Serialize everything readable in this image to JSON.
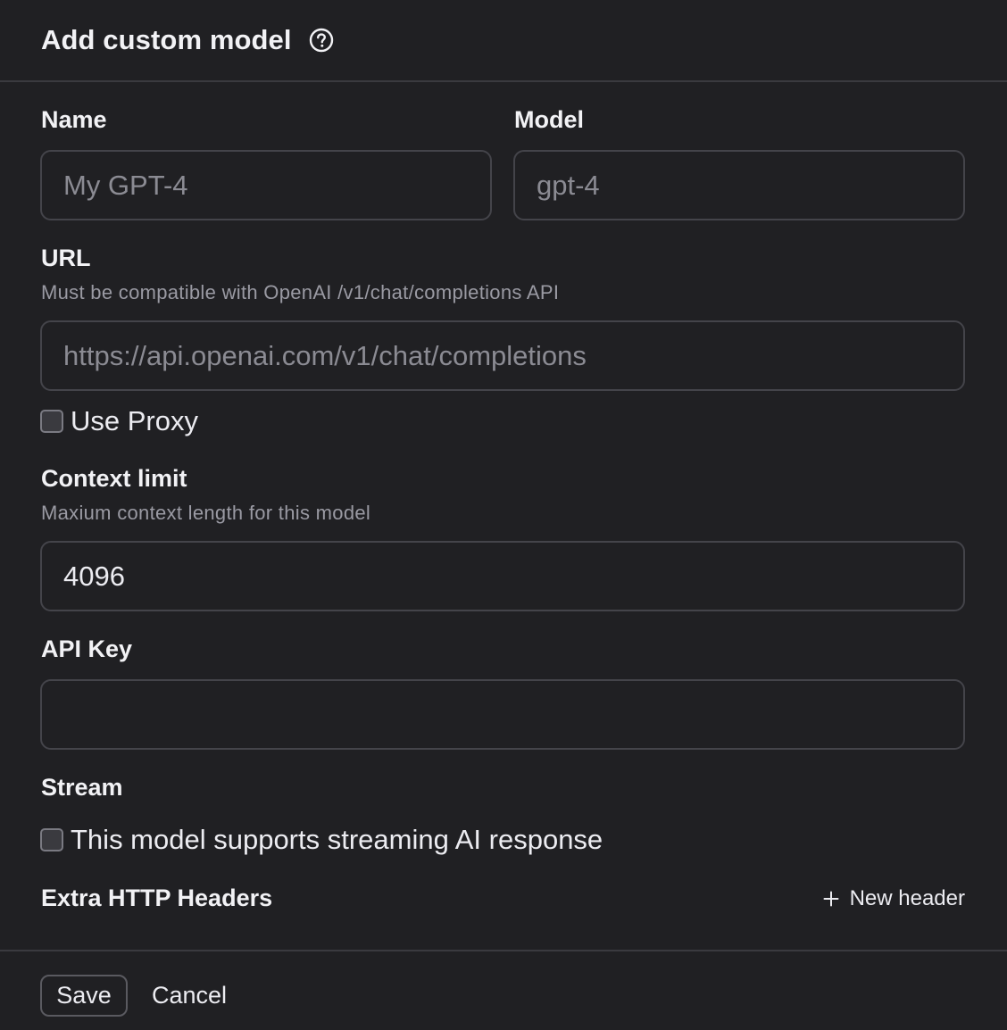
{
  "dialog": {
    "title": "Add custom model"
  },
  "form": {
    "name": {
      "label": "Name",
      "placeholder": "My GPT-4"
    },
    "model": {
      "label": "Model",
      "placeholder": "gpt-4"
    },
    "url": {
      "label": "URL",
      "hint": "Must be compatible with OpenAI /v1/chat/completions API",
      "placeholder": "https://api.openai.com/v1/chat/completions"
    },
    "use_proxy": {
      "label": "Use Proxy",
      "checked": false
    },
    "context_limit": {
      "label": "Context limit",
      "hint": "Maxium context length for this model",
      "value": "4096"
    },
    "api_key": {
      "label": "API Key",
      "value": ""
    },
    "stream": {
      "label": "Stream",
      "checkbox_label": "This model supports streaming AI response",
      "checked": false
    },
    "extra_headers": {
      "label": "Extra HTTP Headers",
      "new_header_label": "New header"
    }
  },
  "footer": {
    "save_label": "Save",
    "cancel_label": "Cancel"
  },
  "icons": {
    "help": "help-circle-icon",
    "plus": "plus-icon"
  }
}
